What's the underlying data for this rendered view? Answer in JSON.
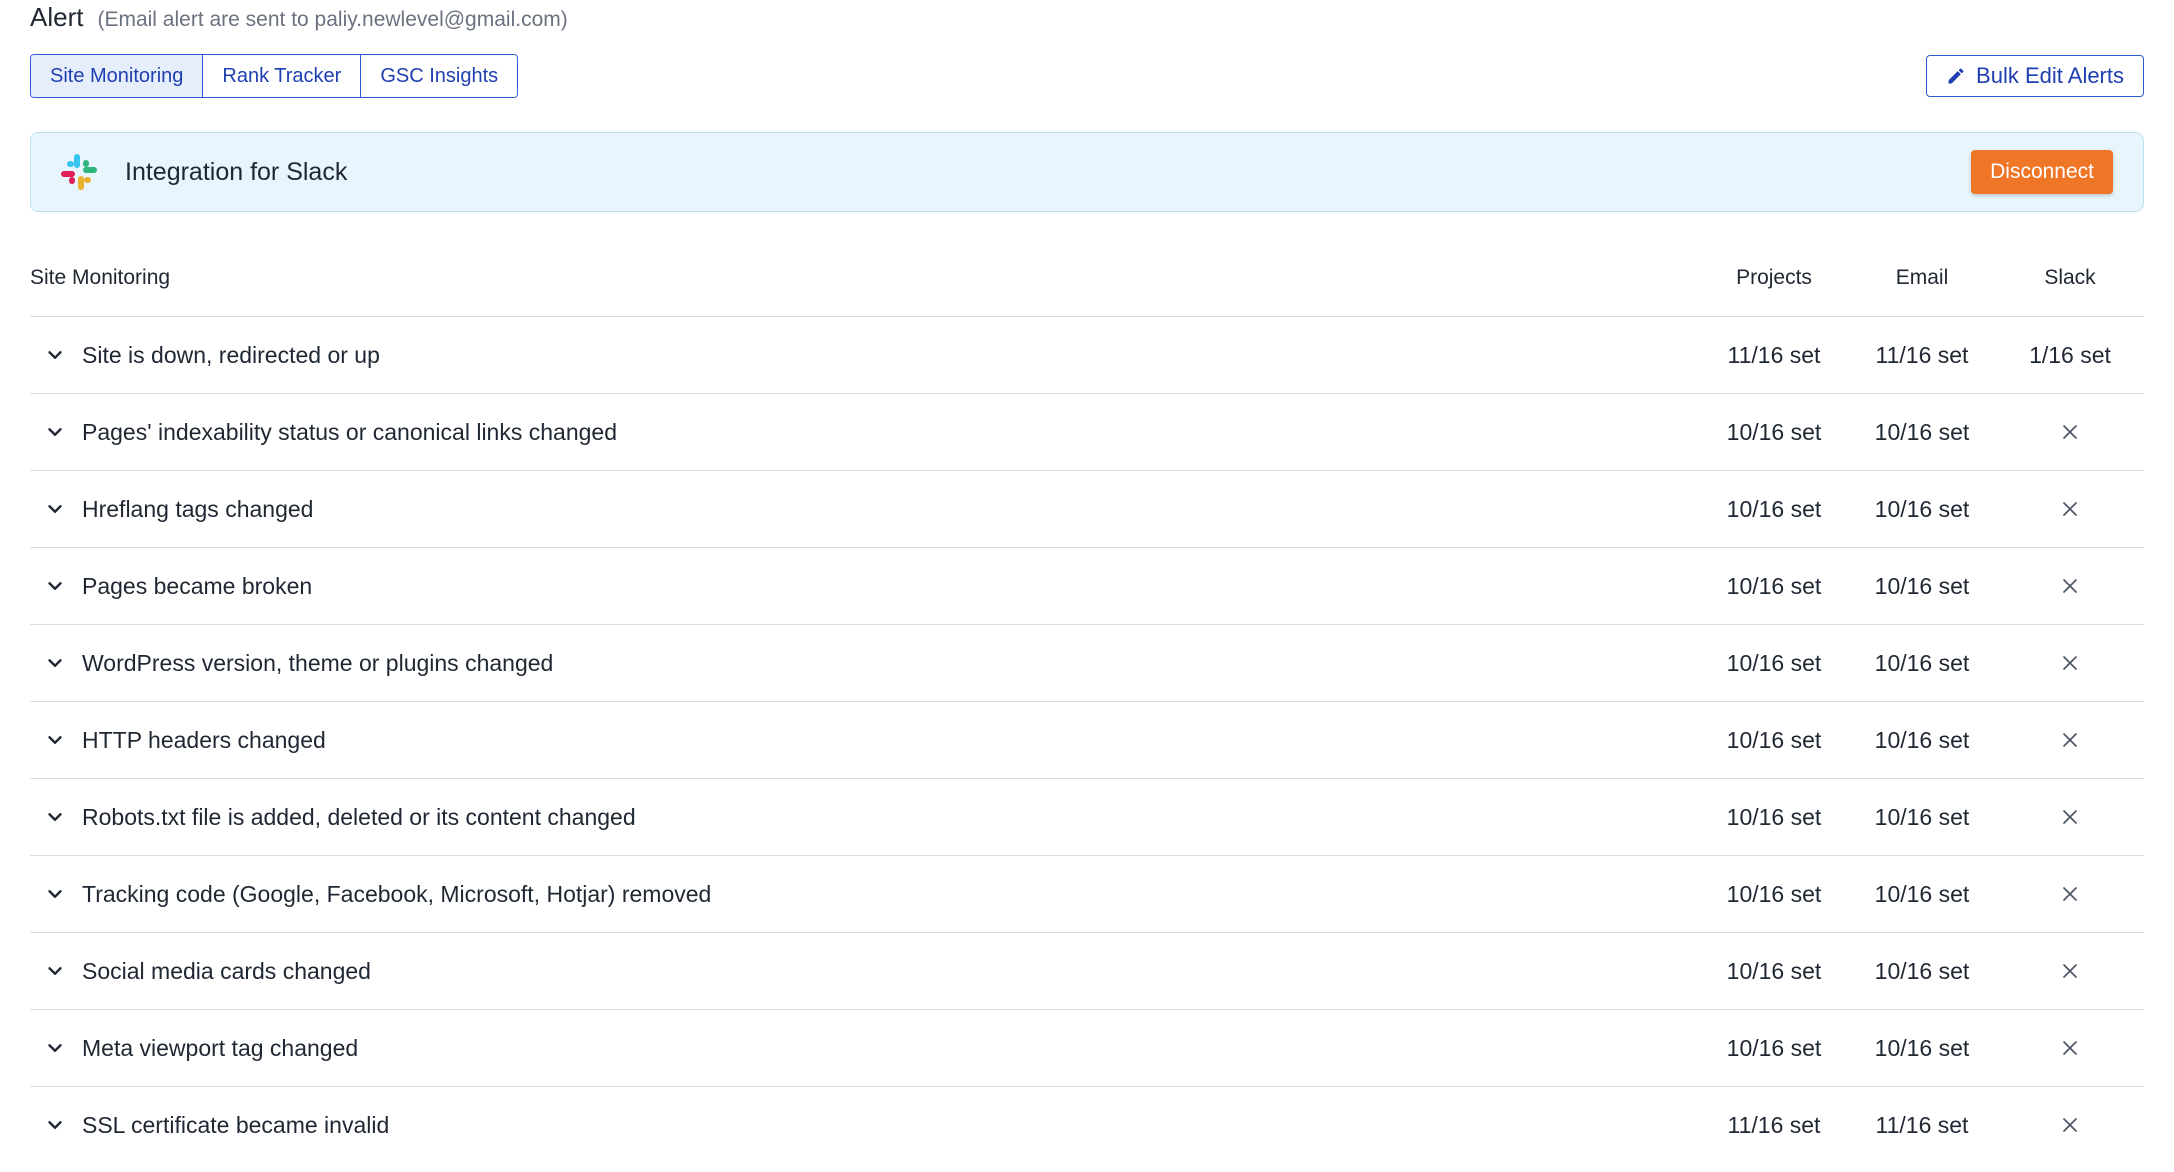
{
  "header": {
    "title": "Alert",
    "note": "(Email alert are sent to paliy.newlevel@gmail.com)"
  },
  "tabs": [
    {
      "label": "Site Monitoring",
      "active": true
    },
    {
      "label": "Rank Tracker",
      "active": false
    },
    {
      "label": "GSC Insights",
      "active": false
    }
  ],
  "toolbar": {
    "bulk_edit_label": "Bulk Edit Alerts",
    "bulk_edit_icon": "pencil-icon"
  },
  "slack": {
    "icon": "slack-logo-icon",
    "title": "Integration for Slack",
    "disconnect_label": "Disconnect"
  },
  "table": {
    "headers": {
      "name": "Site Monitoring",
      "projects": "Projects",
      "email": "Email",
      "slack": "Slack"
    },
    "rows": [
      {
        "name": "Site is down, redirected or up",
        "projects": "11/16 set",
        "email": "11/16 set",
        "slack": "1/16 set"
      },
      {
        "name": "Pages' indexability status or canonical links changed",
        "projects": "10/16 set",
        "email": "10/16 set",
        "slack": null
      },
      {
        "name": "Hreflang tags changed",
        "projects": "10/16 set",
        "email": "10/16 set",
        "slack": null
      },
      {
        "name": "Pages became broken",
        "projects": "10/16 set",
        "email": "10/16 set",
        "slack": null
      },
      {
        "name": "WordPress version, theme or plugins changed",
        "projects": "10/16 set",
        "email": "10/16 set",
        "slack": null
      },
      {
        "name": "HTTP headers changed",
        "projects": "10/16 set",
        "email": "10/16 set",
        "slack": null
      },
      {
        "name": "Robots.txt file is added, deleted or its content changed",
        "projects": "10/16 set",
        "email": "10/16 set",
        "slack": null
      },
      {
        "name": "Tracking code (Google, Facebook, Microsoft, Hotjar) removed",
        "projects": "10/16 set",
        "email": "10/16 set",
        "slack": null
      },
      {
        "name": "Social media cards changed",
        "projects": "10/16 set",
        "email": "10/16 set",
        "slack": null
      },
      {
        "name": "Meta viewport tag changed",
        "projects": "10/16 set",
        "email": "10/16 set",
        "slack": null
      },
      {
        "name": "SSL certificate became invalid",
        "projects": "11/16 set",
        "email": "11/16 set",
        "slack": null
      }
    ]
  },
  "colors": {
    "accent": "#2f5bd4",
    "disconnect": "#ef7627",
    "slack_bar_bg": "#e8f5fc"
  }
}
